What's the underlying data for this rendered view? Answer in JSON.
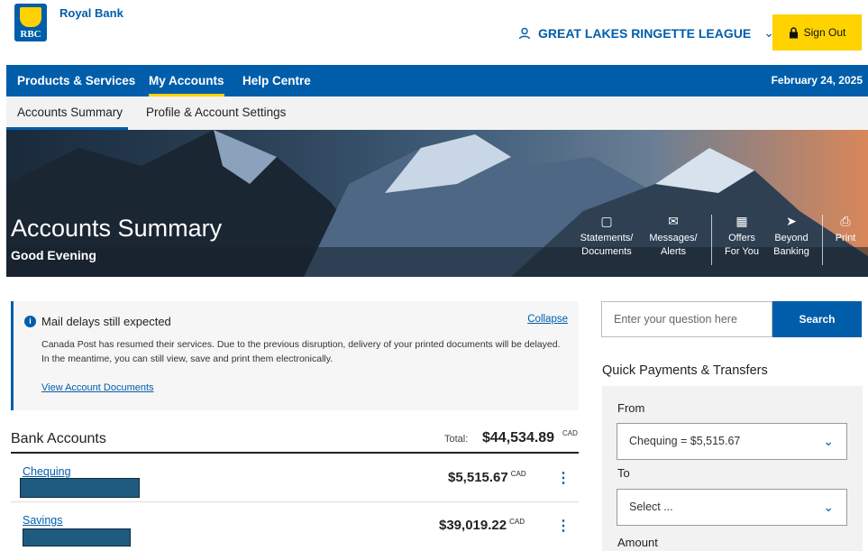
{
  "header": {
    "bank_name": "Royal Bank",
    "logo_text": "RBC",
    "organization": "GREAT LAKES RINGETTE LEAGUE",
    "sign_out_label": "Sign Out"
  },
  "nav": {
    "items": [
      "Products & Services",
      "My Accounts",
      "Help Centre"
    ],
    "active": "My Accounts",
    "date": "February 24, 2025"
  },
  "subnav": {
    "items": [
      "Accounts Summary",
      "Profile & Account Settings"
    ],
    "active": "Accounts Summary"
  },
  "hero": {
    "title": "Accounts Summary",
    "greeting": "Good Evening",
    "quick_links": [
      {
        "line1": "Statements/",
        "line2": "Documents",
        "icon": "document-icon"
      },
      {
        "line1": "Messages/",
        "line2": "Alerts",
        "icon": "mail-icon"
      },
      {
        "line1": "Offers",
        "line2": "For You",
        "icon": "gift-icon"
      },
      {
        "line1": "Beyond",
        "line2": "Banking",
        "icon": "rocket-icon"
      },
      {
        "line1": "Print",
        "line2": "",
        "icon": "printer-icon"
      }
    ]
  },
  "notice": {
    "title": "Mail delays still expected",
    "collapse_label": "Collapse",
    "body": "Canada Post has resumed their services. Due to the previous disruption, delivery of your printed documents will be delayed. In the meantime, you can still view, save and print them electronically.",
    "link": "View Account Documents"
  },
  "bank_accounts": {
    "title": "Bank Accounts",
    "total_label": "Total:",
    "total": "$44,534.89",
    "currency": "CAD",
    "accounts": [
      {
        "name": "Chequing",
        "balance": "$5,515.67",
        "currency": "CAD"
      },
      {
        "name": "Savings",
        "balance": "$39,019.22",
        "currency": "CAD"
      }
    ]
  },
  "search": {
    "placeholder": "Enter your question here",
    "button_label": "Search"
  },
  "quick_payments": {
    "title": "Quick Payments & Transfers",
    "from_label": "From",
    "from_value": "Chequing = $5,515.67",
    "to_label": "To",
    "to_value": "Select ...",
    "amount_label": "Amount"
  },
  "colors": {
    "brand_blue": "#005daa",
    "brand_yellow": "#ffd200"
  }
}
